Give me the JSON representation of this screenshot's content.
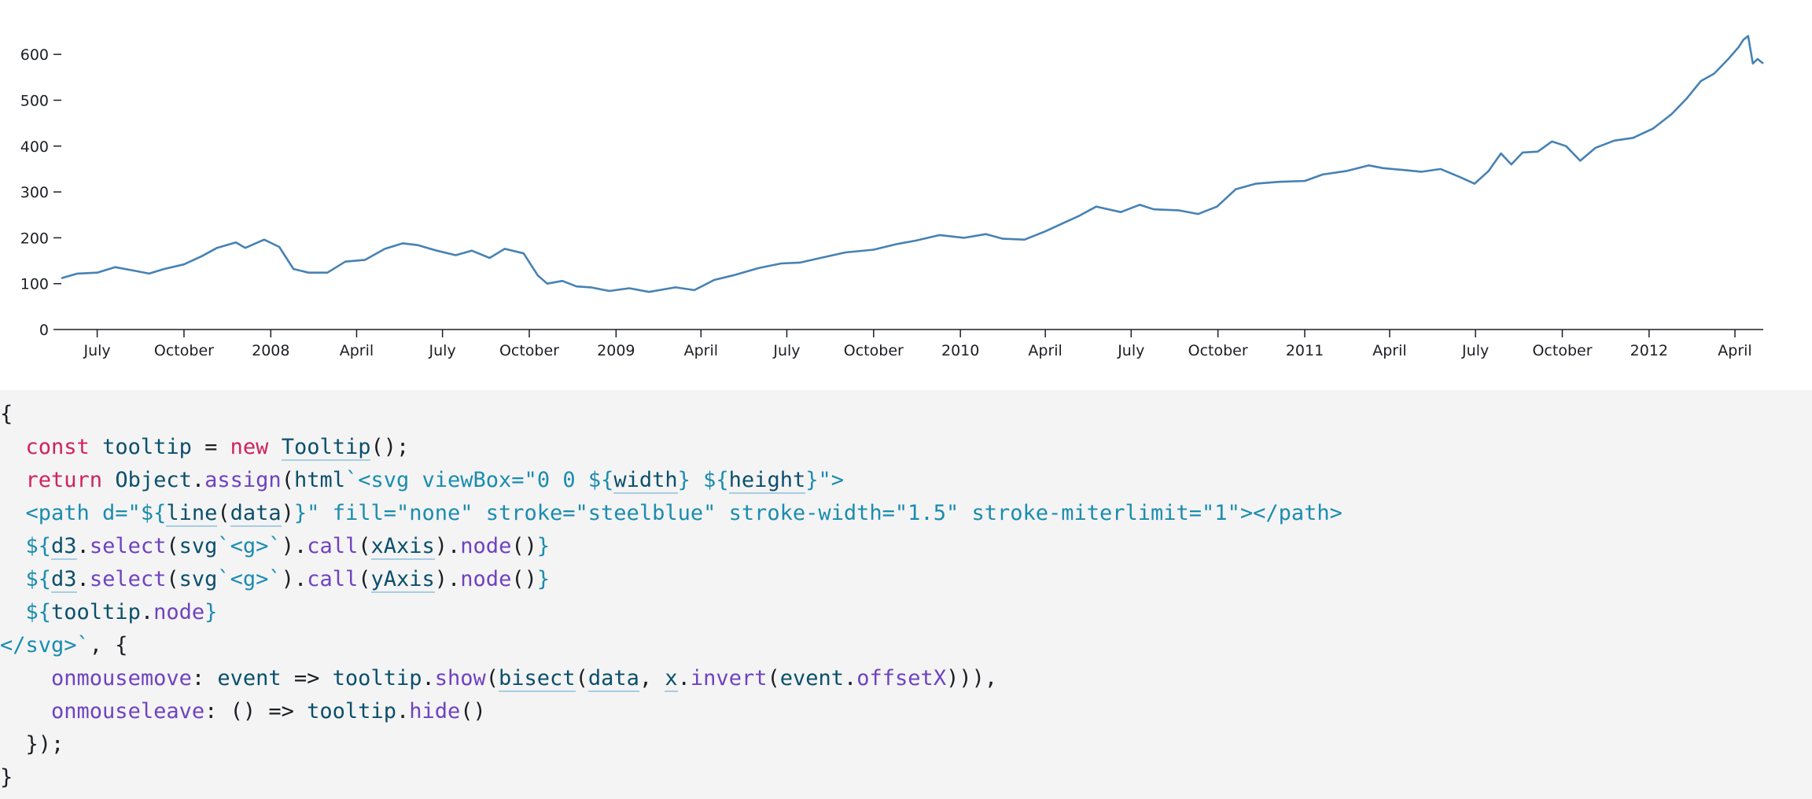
{
  "chart_data": {
    "type": "line",
    "title": "",
    "xlabel": "",
    "ylabel": "",
    "color": "#4682b4",
    "ylim": [
      0,
      650
    ],
    "xlim": [
      "2007-05-24",
      "2012-05-01"
    ],
    "yticks": [
      0,
      100,
      200,
      300,
      400,
      500,
      600
    ],
    "xticks": [
      {
        "date": "2007-07-01",
        "label": "July"
      },
      {
        "date": "2007-10-01",
        "label": "October"
      },
      {
        "date": "2008-01-01",
        "label": "2008"
      },
      {
        "date": "2008-04-01",
        "label": "April"
      },
      {
        "date": "2008-07-01",
        "label": "July"
      },
      {
        "date": "2008-10-01",
        "label": "October"
      },
      {
        "date": "2009-01-01",
        "label": "2009"
      },
      {
        "date": "2009-04-01",
        "label": "April"
      },
      {
        "date": "2009-07-01",
        "label": "July"
      },
      {
        "date": "2009-10-01",
        "label": "October"
      },
      {
        "date": "2010-01-01",
        "label": "2010"
      },
      {
        "date": "2010-04-01",
        "label": "April"
      },
      {
        "date": "2010-07-01",
        "label": "July"
      },
      {
        "date": "2010-10-01",
        "label": "October"
      },
      {
        "date": "2011-01-01",
        "label": "2011"
      },
      {
        "date": "2011-04-01",
        "label": "April"
      },
      {
        "date": "2011-07-01",
        "label": "July"
      },
      {
        "date": "2011-10-01",
        "label": "October"
      },
      {
        "date": "2012-01-01",
        "label": "2012"
      },
      {
        "date": "2012-04-01",
        "label": "April"
      }
    ],
    "series": [
      {
        "x": [
          "2007-05-24",
          "2007-06-10",
          "2007-07-01",
          "2007-07-20",
          "2007-08-10",
          "2007-08-25",
          "2007-09-10",
          "2007-10-01",
          "2007-10-20",
          "2007-11-05",
          "2007-11-25",
          "2007-12-05",
          "2007-12-25",
          "2008-01-10",
          "2008-01-25",
          "2008-02-10",
          "2008-03-01",
          "2008-03-20",
          "2008-04-10",
          "2008-05-01",
          "2008-05-20",
          "2008-06-05",
          "2008-06-25",
          "2008-07-15",
          "2008-08-01",
          "2008-08-20",
          "2008-09-05",
          "2008-09-25",
          "2008-10-10",
          "2008-10-20",
          "2008-11-05",
          "2008-11-20",
          "2008-12-05",
          "2008-12-25",
          "2009-01-15",
          "2009-02-05",
          "2009-03-05",
          "2009-03-25",
          "2009-04-15",
          "2009-05-05",
          "2009-06-01",
          "2009-06-25",
          "2009-07-15",
          "2009-08-10",
          "2009-09-01",
          "2009-10-01",
          "2009-10-25",
          "2009-11-15",
          "2009-12-10",
          "2010-01-05",
          "2010-01-28",
          "2010-02-15",
          "2010-03-10",
          "2010-04-01",
          "2010-04-20",
          "2010-05-07",
          "2010-05-25",
          "2010-06-20",
          "2010-07-10",
          "2010-07-25",
          "2010-08-20",
          "2010-09-10",
          "2010-09-30",
          "2010-10-20",
          "2010-11-10",
          "2010-12-05",
          "2011-01-01",
          "2011-01-20",
          "2011-02-15",
          "2011-03-10",
          "2011-03-25",
          "2011-04-15",
          "2011-05-05",
          "2011-05-25",
          "2011-06-15",
          "2011-06-30",
          "2011-07-15",
          "2011-07-28",
          "2011-08-08",
          "2011-08-20",
          "2011-09-05",
          "2011-09-20",
          "2011-10-05",
          "2011-10-20",
          "2011-11-05",
          "2011-11-25",
          "2011-12-15",
          "2012-01-05",
          "2012-01-25",
          "2012-02-10",
          "2012-02-25",
          "2012-03-10",
          "2012-03-25",
          "2012-04-05",
          "2012-04-10",
          "2012-04-15",
          "2012-04-20",
          "2012-04-25",
          "2012-05-01"
        ],
        "y": [
          112,
          122,
          124,
          136,
          128,
          122,
          132,
          142,
          160,
          178,
          190,
          178,
          196,
          180,
          132,
          124,
          124,
          148,
          152,
          176,
          188,
          184,
          172,
          162,
          172,
          156,
          176,
          166,
          118,
          100,
          106,
          94,
          92,
          84,
          90,
          82,
          92,
          86,
          108,
          118,
          134,
          144,
          146,
          158,
          168,
          174,
          186,
          194,
          206,
          200,
          208,
          198,
          196,
          214,
          232,
          248,
          268,
          256,
          272,
          262,
          260,
          252,
          268,
          306,
          318,
          322,
          324,
          338,
          346,
          358,
          352,
          348,
          344,
          350,
          332,
          318,
          346,
          384,
          360,
          386,
          388,
          410,
          400,
          368,
          396,
          412,
          418,
          438,
          470,
          504,
          542,
          558,
          590,
          616,
          632,
          640,
          580,
          590,
          580
        ]
      }
    ]
  },
  "code": {
    "l1": "{",
    "l2": {
      "kw1": "const",
      "name": "tooltip",
      "eq": " = ",
      "kw2": "new",
      "cls": "Tooltip",
      "end": "();"
    },
    "l3": {
      "kw": "return",
      "obj": "Object",
      "dot": ".",
      "fn": "assign",
      "p1": "(",
      "tag": "html",
      "s1": "`<svg viewBox=\"0 0 ${",
      "w": "width",
      "s2": "} ${",
      "h": "height",
      "s3": "}\">"
    },
    "l4": {
      "s1": "<path d=\"${",
      "line": "line",
      "p1": "(",
      "data": "data",
      "p2": ")",
      "s2": "}\" fill=\"none\" stroke=\"steelblue\" stroke-width=\"1.5\" stroke-miterlimit=\"1\"></path>"
    },
    "l5": {
      "s1": "${",
      "d3": "d3",
      "dot1": ".",
      "sel": "select",
      "p1": "(",
      "svg": "svg",
      "s2": "`<g>`",
      "p2": ").",
      "call": "call",
      "p3": "(",
      "axis": "xAxis",
      "p4": ").",
      "node": "node",
      "p5": "()",
      "s3": "}"
    },
    "l6": {
      "s1": "${",
      "d3": "d3",
      "dot1": ".",
      "sel": "select",
      "p1": "(",
      "svg": "svg",
      "s2": "`<g>`",
      "p2": ").",
      "call": "call",
      "p3": "(",
      "axis": "yAxis",
      "p4": ").",
      "node": "node",
      "p5": "()",
      "s3": "}"
    },
    "l7": {
      "s1": "${",
      "tt": "tooltip",
      "dot": ".",
      "node": "node",
      "s2": "}"
    },
    "l8": {
      "s1": "</svg>`",
      "rest": ", {"
    },
    "l9": {
      "prop": "onmousemove",
      "c1": ": ",
      "ev": "event",
      "arrow": " => ",
      "tt": "tooltip",
      "dot1": ".",
      "show": "show",
      "p1": "(",
      "bis": "bisect",
      "p2": "(",
      "data": "data",
      "comma": ", ",
      "x": "x",
      "dot2": ".",
      "inv": "invert",
      "p3": "(",
      "ev2": "event",
      "dot3": ".",
      "off": "offsetX",
      "end": "))),"
    },
    "l10": {
      "prop": "onmouseleave",
      "c1": ": () => ",
      "tt": "tooltip",
      "dot": ".",
      "hide": "hide",
      "end": "()"
    },
    "l11": "});",
    "l12": "}"
  }
}
